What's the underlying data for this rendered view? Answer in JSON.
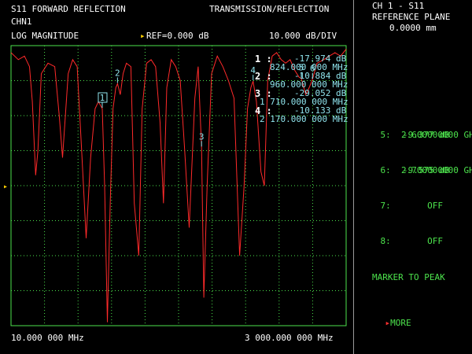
{
  "header": {
    "title_left": "S11 FORWARD REFLECTION",
    "channel": "CHN1",
    "title_right": "TRANSMISSION/REFLECTION",
    "format": "LOG MAGNITUDE",
    "ref_arrow": "▸",
    "ref_label": "REF=0.000 dB",
    "scale": "10.000 dB/DIV"
  },
  "footer": {
    "start": "10.000 000 MHz",
    "stop": "3 000.000 000 MHz"
  },
  "markers_table": [
    {
      "num": "1 :",
      "value": "-17.974 dB",
      "freq": "824.000 000 MHz"
    },
    {
      "num": "2 :",
      "value": "-10.884 dB",
      "freq": "960.000 000 MHz"
    },
    {
      "num": "3 :",
      "value": "-29.052 dB",
      "freq": "1 710.000 000 MHz"
    },
    {
      "num": "4 :",
      "value": "-10.133 dB",
      "freq": "2 170.000 000 MHz"
    }
  ],
  "marker_labels": [
    "1",
    "2",
    "3",
    "4",
    "5",
    "6"
  ],
  "ref_marker": "▸",
  "side_panel": {
    "header_line1": "CH 1 - S11",
    "header_line2": "REFERENCE PLANE",
    "header_line3": "0.0000 mm",
    "m5_label": "5:",
    "m5_freq": "2.600000000 GHz",
    "m5_value": "-9.377 dB",
    "m6_label": "6:",
    "m6_freq": "2.700000000 GHz",
    "m6_value": "-9.575 dB",
    "m7_label": "7:",
    "m7_state": "OFF",
    "m8_label": "8:",
    "m8_state": "OFF",
    "marker_to_peak": "MARKER TO PEAK",
    "more_arrow": "▸",
    "more": "MORE"
  },
  "colors": {
    "grid": "#4ce24c",
    "trace": "#ff2a2a",
    "marker": "#8fe3ec",
    "text": "#4ce24c"
  },
  "chart_data": {
    "type": "line",
    "title": "S11 FORWARD REFLECTION",
    "xlabel": "",
    "ylabel": "",
    "x_unit": "MHz",
    "y_unit": "dB",
    "xlim": [
      10,
      3000
    ],
    "ylim": [
      -80,
      0
    ],
    "ref_level_db": 0,
    "db_per_div": 10,
    "grid": true,
    "series": [
      {
        "x": [
          10,
          75,
          130,
          175,
          200,
          230,
          250,
          280,
          340,
          400,
          440,
          470,
          520,
          560,
          600,
          640,
          680,
          720,
          760,
          790,
          824,
          845,
          870,
          895,
          920,
          945,
          960,
          985,
          1010,
          1040,
          1080,
          1110,
          1150,
          1180,
          1220,
          1260,
          1300,
          1340,
          1370,
          1400,
          1440,
          1480,
          1520,
          1560,
          1600,
          1650,
          1680,
          1710,
          1730,
          1760,
          1800,
          1850,
          1900,
          1950,
          2000,
          2050,
          2090,
          2120,
          2150,
          2170,
          2200,
          2240,
          2270,
          2300,
          2340,
          2380,
          2420,
          2460,
          2500,
          2540,
          2580,
          2600,
          2640,
          2670,
          2700,
          2740,
          2800,
          2850,
          2900,
          2950,
          3000
        ],
        "y": [
          -2,
          -4,
          -3,
          -6,
          -16,
          -37,
          -30,
          -8,
          -5,
          -6,
          -20,
          -32,
          -8,
          -4,
          -6,
          -30,
          -55,
          -32,
          -18,
          -16,
          -17.974,
          -40,
          -79,
          -45,
          -18,
          -12,
          -10.884,
          -14,
          -8,
          -5,
          -6,
          -45,
          -60,
          -18,
          -5,
          -4,
          -6,
          -22,
          -45,
          -12,
          -4,
          -6,
          -10,
          -30,
          -52,
          -15,
          -6,
          -29.052,
          -72,
          -40,
          -8,
          -3,
          -6,
          -10,
          -15,
          -60,
          -40,
          -18,
          -12,
          -10.133,
          -16,
          -36,
          -40,
          -10,
          -3,
          -2,
          -4,
          -5,
          -4,
          -7,
          -9,
          -9.377,
          -14,
          -12,
          -9.575,
          -5,
          -4,
          -3,
          -2,
          -3,
          -1
        ]
      }
    ],
    "markers": [
      {
        "label": "1",
        "x": 824,
        "y": -17.974
      },
      {
        "label": "2",
        "x": 960,
        "y": -10.884
      },
      {
        "label": "3",
        "x": 1710,
        "y": -29.052
      },
      {
        "label": "4",
        "x": 2170,
        "y": -10.133
      },
      {
        "label": "5",
        "x": 2600,
        "y": -9.377
      },
      {
        "label": "6",
        "x": 2700,
        "y": -9.575
      }
    ]
  }
}
